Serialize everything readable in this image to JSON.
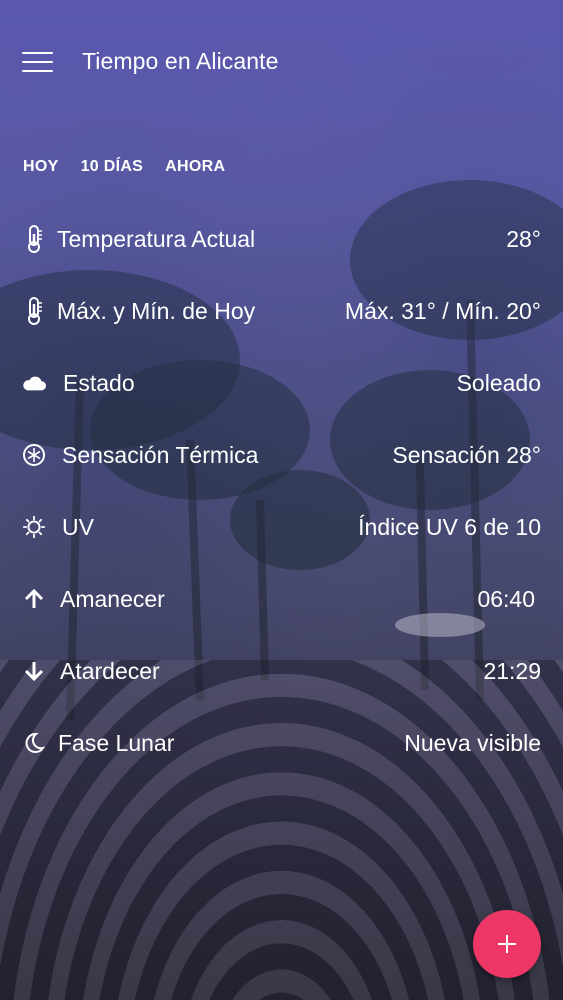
{
  "app": {
    "title": "Tiempo en Alicante"
  },
  "tabs": [
    {
      "label": "HOY"
    },
    {
      "label": "10 DÍAS"
    },
    {
      "label": "AHORA"
    }
  ],
  "rows": [
    {
      "icon": "thermometer-icon",
      "label": "Temperatura Actual",
      "value": "28°"
    },
    {
      "icon": "thermometer-icon",
      "label": "Máx. y Mín. de Hoy",
      "value": "Máx. 31° / Mín. 20°"
    },
    {
      "icon": "cloud-icon",
      "label": "Estado",
      "value": "Soleado"
    },
    {
      "icon": "snowflake-icon",
      "label": "Sensación Térmica",
      "value": "Sensación 28°"
    },
    {
      "icon": "sun-icon",
      "label": "UV",
      "value": "Índice UV 6 de 10"
    },
    {
      "icon": "arrow-up-icon",
      "label": "Amanecer",
      "value": "06:40"
    },
    {
      "icon": "arrow-down-icon",
      "label": "Atardecer",
      "value": "21:29"
    },
    {
      "icon": "moon-icon",
      "label": "Fase Lunar",
      "value": "Nueva visible"
    }
  ],
  "colors": {
    "header_tint": "#5b57b4",
    "fab": "#ee3766",
    "text": "#ffffff"
  }
}
